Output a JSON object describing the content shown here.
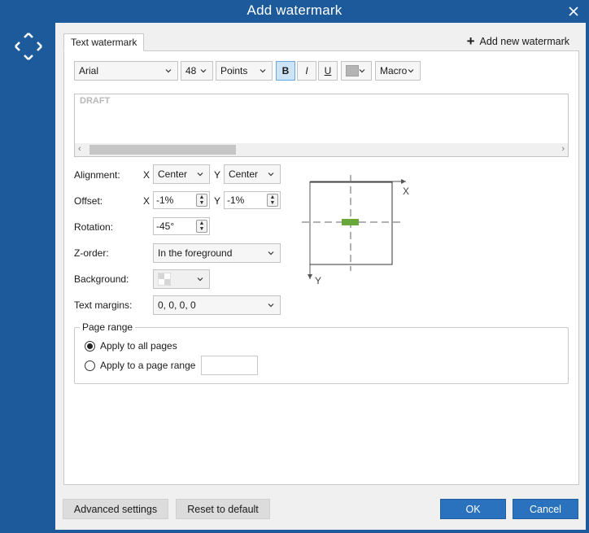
{
  "window": {
    "title": "Add watermark"
  },
  "tabs": [
    {
      "label": "Text watermark"
    }
  ],
  "add_new": {
    "label": "Add new watermark"
  },
  "toolbar": {
    "font": "Arial",
    "size": "48",
    "units": "Points",
    "bold": "B",
    "italic": "I",
    "underline": "U",
    "macro": "Macro",
    "color": "#b4b4b4"
  },
  "text": {
    "value": "DRAFT"
  },
  "form": {
    "alignment_label": "Alignment:",
    "x_axis": "X",
    "y_axis": "Y",
    "align_x": "Center",
    "align_y": "Center",
    "offset_label": "Offset:",
    "offset_x": "-1%",
    "offset_y": "-1%",
    "rotation_label": "Rotation:",
    "rotation": "-45°",
    "zorder_label": "Z-order:",
    "zorder": "In the foreground",
    "background_label": "Background:",
    "margins_label": "Text margins:",
    "margins": "0, 0, 0, 0"
  },
  "diagram": {
    "x_label": "X",
    "y_label": "Y",
    "marker_color": "#6aa73b"
  },
  "page_range": {
    "legend": "Page range",
    "all_pages": "Apply to all pages",
    "range": "Apply to a page range",
    "selected": "all"
  },
  "footer": {
    "advanced": "Advanced settings",
    "reset": "Reset to default",
    "ok": "OK",
    "cancel": "Cancel"
  },
  "colors": {
    "titlebar": "#1c5a9c",
    "primary_button": "#2a72bd"
  }
}
